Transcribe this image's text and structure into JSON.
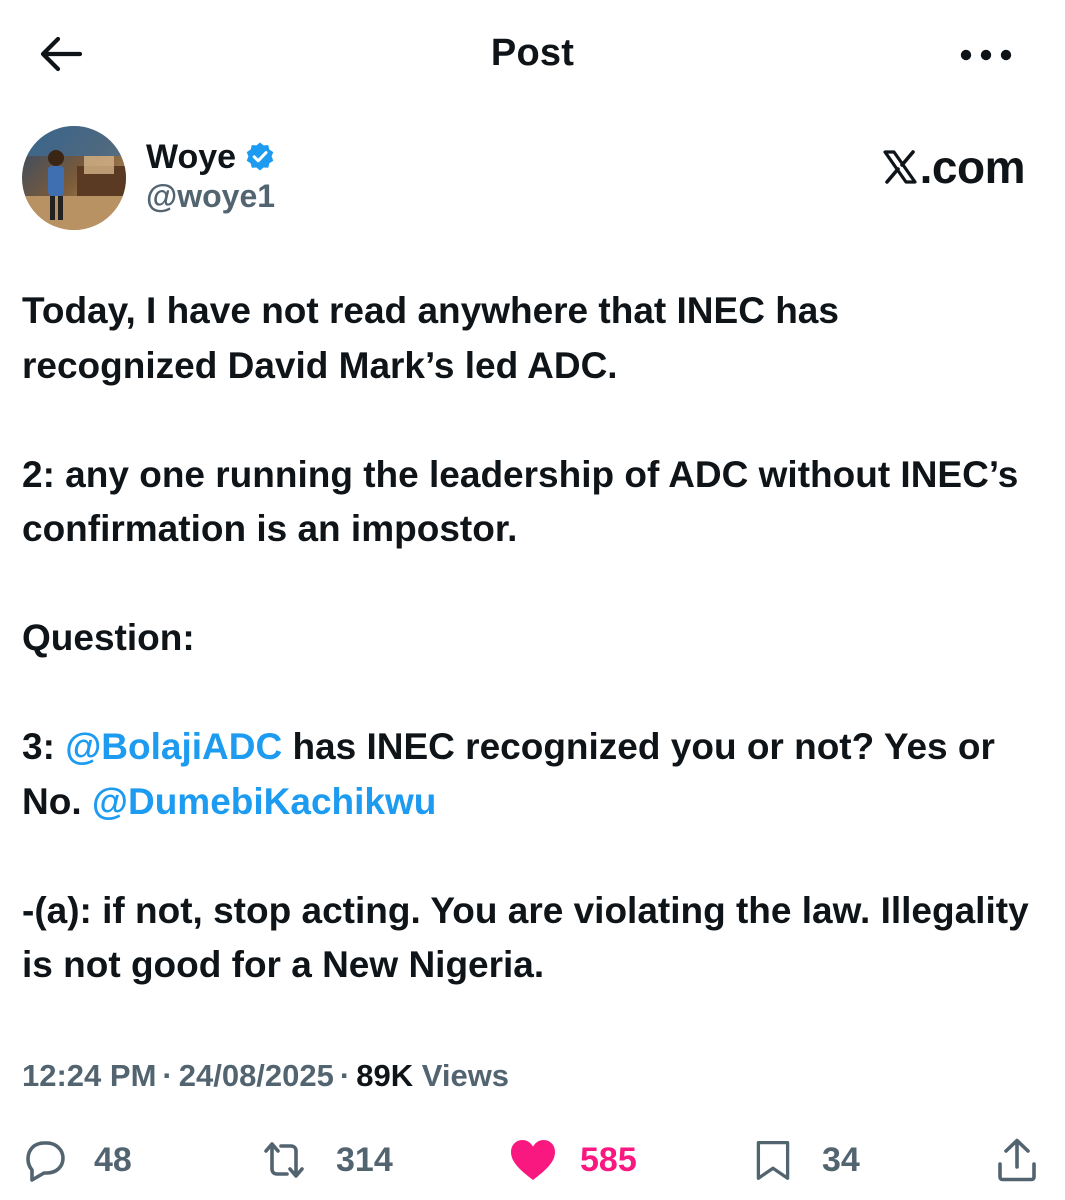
{
  "header": {
    "title": "Post",
    "back_icon": "arrow-left-icon",
    "more_icon": "more-horizontal-icon"
  },
  "author": {
    "name": "Woye",
    "handle": "@woye1",
    "verified": true,
    "verified_color": "#1d9bf0"
  },
  "brand": {
    "text": ".com",
    "logo": "x-logo-icon"
  },
  "tweet": {
    "paragraphs": [
      {
        "text": "Today, I have not read anywhere that INEC has recognized David Mark’s led ADC."
      },
      {
        "text": "2: any one running the leadership of ADC without INEC’s confirmation is an impostor."
      },
      {
        "text": "Question:"
      },
      {
        "prefix": "3: ",
        "mention1": "@BolajiADC",
        "middle": " has INEC recognized you or not? Yes or No. ",
        "mention2": "@DumebiKachikwu"
      },
      {
        "text": "-(a): if not, stop acting. You are violating the law. Illegality is not good for a New Nigeria."
      }
    ]
  },
  "meta": {
    "time": "12:24 PM",
    "separator": "·",
    "date": "24/08/2025",
    "views_count": "89K",
    "views_label": "Views"
  },
  "actions": {
    "replies": {
      "icon": "reply-icon",
      "count": "48"
    },
    "reposts": {
      "icon": "repost-icon",
      "count": "314"
    },
    "likes": {
      "icon": "heart-icon",
      "count": "585",
      "liked": true,
      "color": "#f91880"
    },
    "bookmarks": {
      "icon": "bookmark-icon",
      "count": "34"
    },
    "share": {
      "icon": "share-icon"
    }
  },
  "colors": {
    "text": "#0f1419",
    "secondary": "#536471",
    "link": "#1d9bf0",
    "like": "#f91880"
  }
}
